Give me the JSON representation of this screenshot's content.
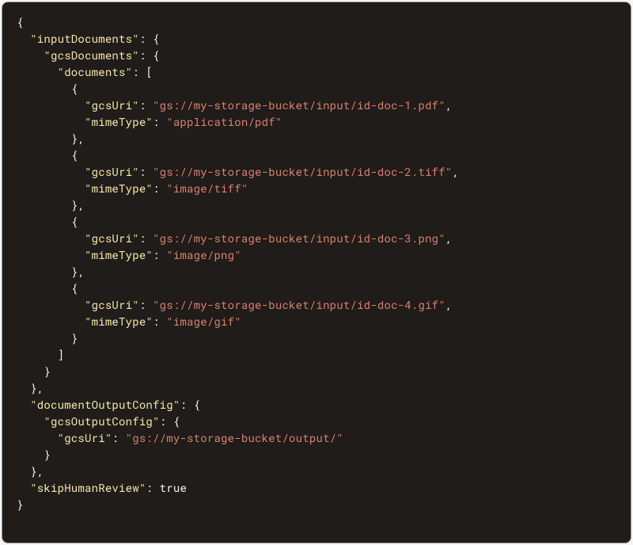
{
  "code": {
    "keys": {
      "inputDocuments": "\"inputDocuments\"",
      "gcsDocuments": "\"gcsDocuments\"",
      "documents": "\"documents\"",
      "gcsUri": "\"gcsUri\"",
      "mimeType": "\"mimeType\"",
      "documentOutputConfig": "\"documentOutputConfig\"",
      "gcsOutputConfig": "\"gcsOutputConfig\"",
      "skipHumanReview": "\"skipHumanReview\""
    },
    "values": {
      "doc1uri": "\"gs://my-storage-bucket/input/id-doc-1.pdf\"",
      "doc1mime": "\"application/pdf\"",
      "doc2uri": "\"gs://my-storage-bucket/input/id-doc-2.tiff\"",
      "doc2mime": "\"image/tiff\"",
      "doc3uri": "\"gs://my-storage-bucket/input/id-doc-3.png\"",
      "doc3mime": "\"image/png\"",
      "doc4uri": "\"gs://my-storage-bucket/input/id-doc-4.gif\"",
      "doc4mime": "\"image/gif\"",
      "outputUri": "\"gs://my-storage-bucket/output/\"",
      "skipHumanReview": "true"
    },
    "punct": {
      "obrace": "{",
      "cbrace": "}",
      "obracket": "[",
      "cbracket": "]",
      "colon": ":",
      "comma": ",",
      "colonSpace": ": ",
      "cbraceComma": "},",
      "cbracketClose": "]"
    }
  }
}
